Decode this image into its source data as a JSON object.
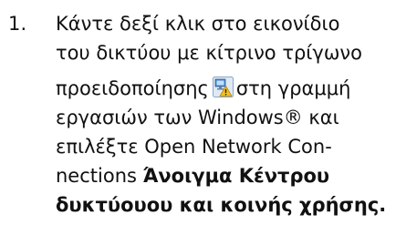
{
  "step": {
    "number": "1.",
    "lines": {
      "l1": "Κάντε δεξί κλικ στο εικονίδιο",
      "l2": "του δικτύου με κίτρινο τρίγωνο",
      "l3_before_icon": "προειδοποίησης",
      "l3_after_icon": "στη γραμμή",
      "l4": "εργασιών των Windows® και",
      "l5": "επιλέξτε Open Network Con-",
      "l6_regular": "nections ",
      "l6_bold": "Άνοιγμα Κέντρου",
      "l7_bold": "δυκτύουου και κοινής χρήσης."
    },
    "icon": "network-warning-icon"
  },
  "colors": {
    "text": "#111111",
    "icon_blue": "#4a86c8",
    "icon_warning": "#f4c21a"
  }
}
